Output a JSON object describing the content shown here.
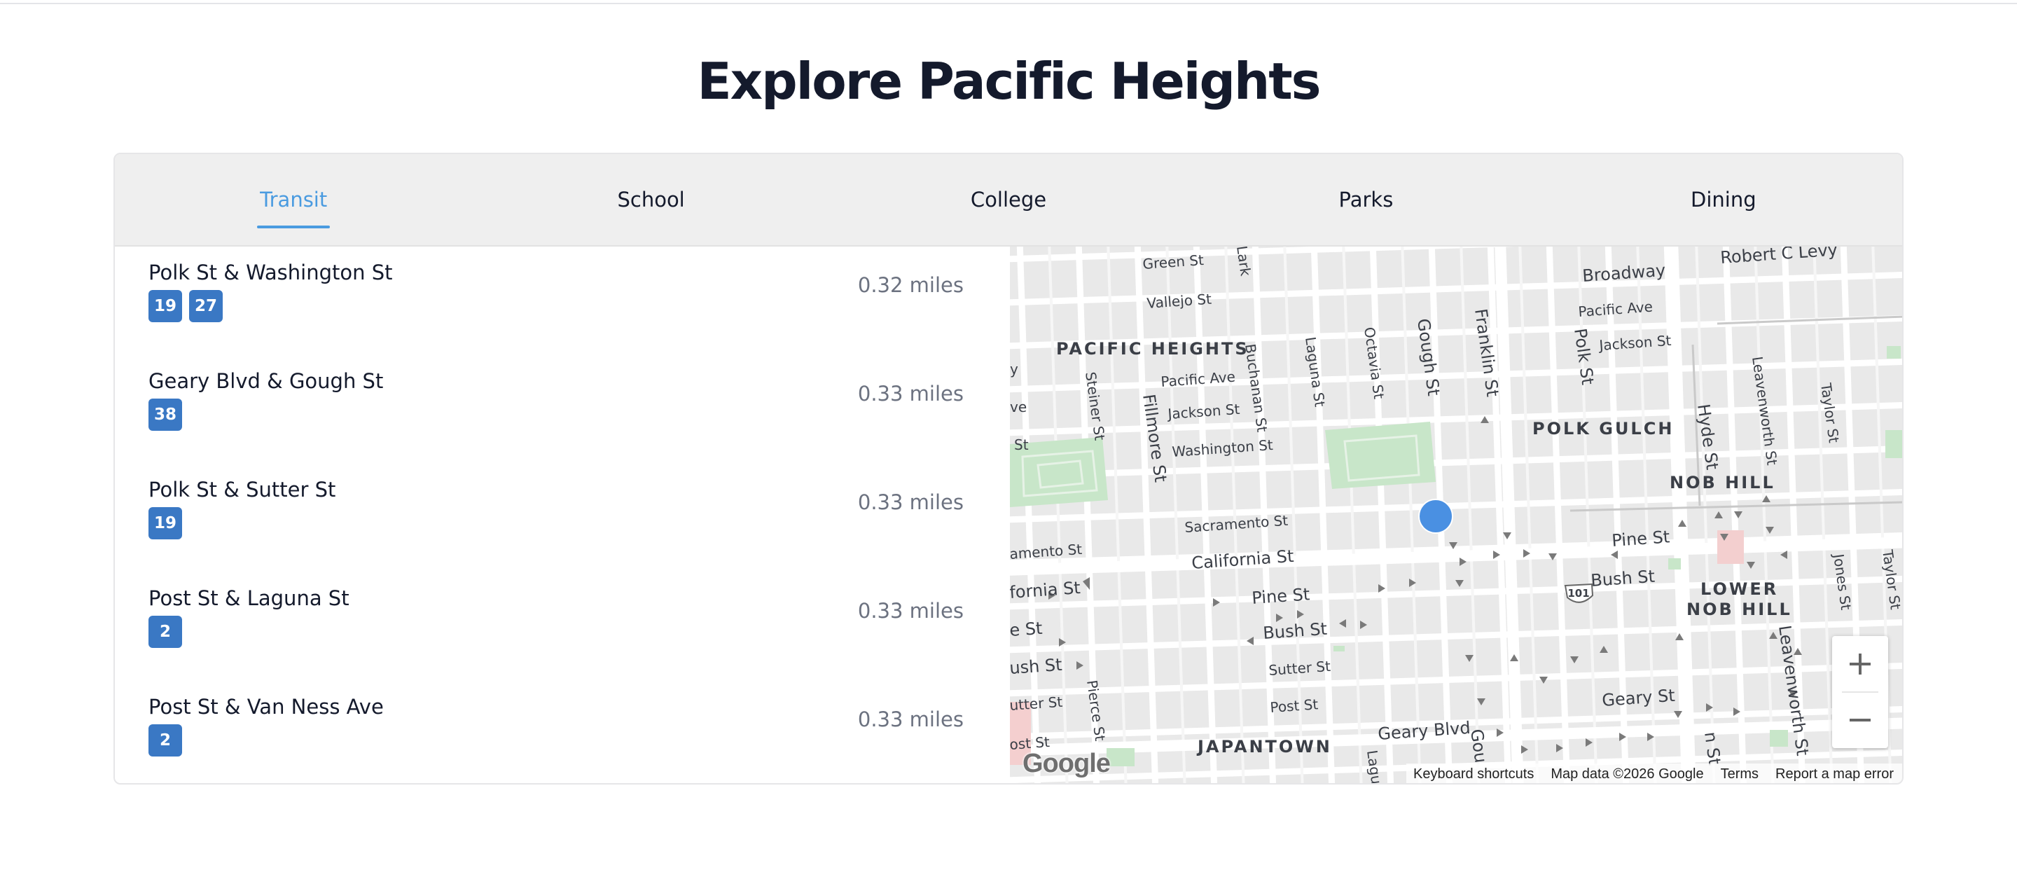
{
  "page": {
    "title": "Explore Pacific Heights"
  },
  "tabs": [
    {
      "label": "Transit",
      "active": true
    },
    {
      "label": "School",
      "active": false
    },
    {
      "label": "College",
      "active": false
    },
    {
      "label": "Parks",
      "active": false
    },
    {
      "label": "Dining",
      "active": false
    }
  ],
  "transit_stops": [
    {
      "name": "Polk St & Washington St",
      "routes": [
        "19",
        "27"
      ],
      "distance": "0.32 miles"
    },
    {
      "name": "Geary Blvd & Gough St",
      "routes": [
        "38"
      ],
      "distance": "0.33 miles"
    },
    {
      "name": "Polk St & Sutter St",
      "routes": [
        "19"
      ],
      "distance": "0.33 miles"
    },
    {
      "name": "Post St & Laguna St",
      "routes": [
        "2"
      ],
      "distance": "0.33 miles"
    },
    {
      "name": "Post St & Van Ness Ave",
      "routes": [
        "2"
      ],
      "distance": "0.33 miles"
    }
  ],
  "map": {
    "neighborhood_labels": [
      "PACIFIC HEIGHTS",
      "POLK GULCH",
      "NOB HILL",
      "LOWER",
      "NOB HILL",
      "JAPANTOWN"
    ],
    "street_labels": [
      "Green St",
      "Vallejo St",
      "Pacific Ave",
      "Jackson St",
      "Washington St",
      "Sacramento St",
      "California St",
      "Pine St",
      "Bush St",
      "Sutter St",
      "Post St",
      "Geary Blvd",
      "Fillmore St",
      "Steiner St",
      "Buchanan St",
      "Laguna St",
      "Octavia St",
      "Gough St",
      "Franklin St",
      "Polk St",
      "Broadway",
      "Robert C Levy",
      "Hyde St",
      "Leavenworth St",
      "Taylor St",
      "Jones St",
      "Larkin St",
      "Pierce St",
      "amento St",
      "fornia St",
      "e St",
      "ush St",
      "utter St",
      "ost St",
      "Pine St",
      "Bush St",
      "Geary St",
      "Pacific Ave",
      "Jackson St",
      "Gou",
      "Lagu",
      "Lark",
      "n St",
      "y",
      "ve",
      "St"
    ],
    "highway_shield": "101",
    "logo_text": "Google",
    "attribution": {
      "shortcuts": "Keyboard shortcuts",
      "map_data": "Map data ©2026 Google",
      "terms": "Terms",
      "report": "Report a map error"
    },
    "colors": {
      "marker": "#4a90e2",
      "park": "#c8e6c9",
      "road": "#ffffff",
      "background": "#e9e9e9"
    }
  },
  "colors": {
    "accent": "#4a9be0",
    "route_badge": "#3a78c4",
    "tab_bar": "#efefef"
  }
}
